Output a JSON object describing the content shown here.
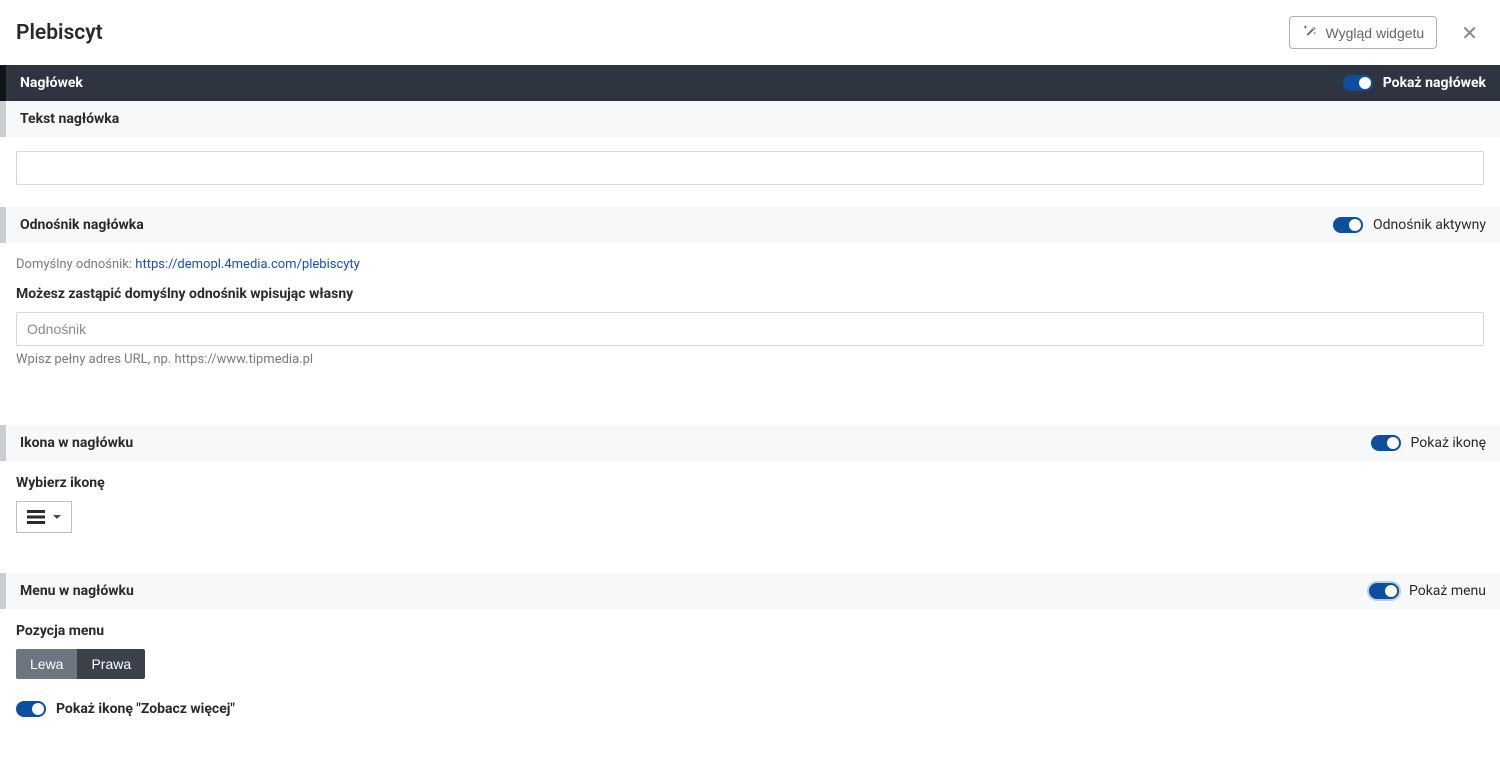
{
  "modal": {
    "title": "Plebiscyt",
    "widget_button": "Wygląd widgetu"
  },
  "header_section": {
    "title": "Nagłówek",
    "toggle_label": "Pokaż nagłówek"
  },
  "text_section": {
    "title": "Tekst nagłówka",
    "value": ""
  },
  "link_section": {
    "title": "Odnośnik nagłówka",
    "toggle_label": "Odnośnik aktywny",
    "default_label": "Domyślny odnośnik:",
    "default_url": "https://demopl.4media.com/plebiscyty",
    "override_label": "Możesz zastąpić domyślny odnośnik wpisując własny",
    "placeholder": "Odnośnik",
    "value": "",
    "hint": "Wpisz pełny adres URL, np. https://www.tipmedia.pl"
  },
  "icon_section": {
    "title": "Ikona w nagłówku",
    "toggle_label": "Pokaż ikonę",
    "choose_label": "Wybierz ikonę"
  },
  "menu_section": {
    "title": "Menu w nagłówku",
    "toggle_label": "Pokaż menu",
    "position_label": "Pozycja menu",
    "options": {
      "left": "Lewa",
      "right": "Prawa"
    },
    "show_more_icon_label": "Pokaż ikonę \"Zobacz więcej\""
  }
}
